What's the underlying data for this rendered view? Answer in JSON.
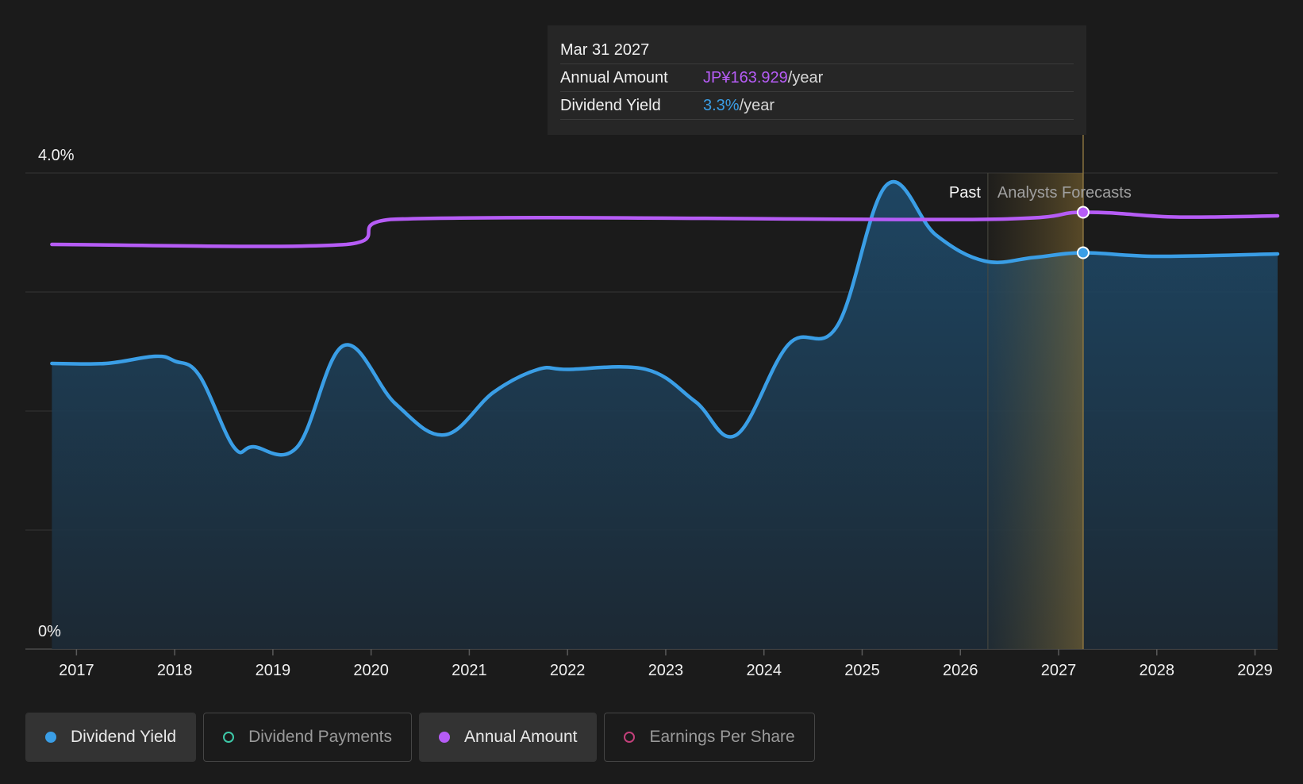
{
  "chart_data": {
    "type": "area",
    "y_ticks": [
      "4.0%",
      "0%"
    ],
    "ylim": [
      0,
      4.0
    ],
    "x_ticks": [
      "2017",
      "2018",
      "2019",
      "2020",
      "2021",
      "2022",
      "2023",
      "2024",
      "2025",
      "2026",
      "2027",
      "2028",
      "2029"
    ],
    "x_range": [
      2016.48,
      2029.23
    ],
    "grid": true,
    "past_label": "Past",
    "forecast_label": "Analysts Forecasts",
    "forecast_start": 2026.28,
    "highlight_x": 2027.25,
    "series": [
      {
        "name": "Dividend Yield",
        "color": "#3a9ee6",
        "points": [
          [
            2016.75,
            2.4
          ],
          [
            2017.3,
            2.4
          ],
          [
            2017.8,
            2.46
          ],
          [
            2018.0,
            2.42
          ],
          [
            2018.25,
            2.3
          ],
          [
            2018.6,
            1.7
          ],
          [
            2018.8,
            1.7
          ],
          [
            2019.25,
            1.7
          ],
          [
            2019.72,
            2.55
          ],
          [
            2020.25,
            2.06
          ],
          [
            2020.75,
            1.8
          ],
          [
            2021.25,
            2.16
          ],
          [
            2021.7,
            2.35
          ],
          [
            2022.0,
            2.35
          ],
          [
            2022.8,
            2.35
          ],
          [
            2023.3,
            2.08
          ],
          [
            2023.72,
            1.8
          ],
          [
            2024.25,
            2.56
          ],
          [
            2024.75,
            2.72
          ],
          [
            2025.25,
            3.9
          ],
          [
            2025.75,
            3.48
          ],
          [
            2026.25,
            3.26
          ],
          [
            2026.75,
            3.29
          ],
          [
            2027.25,
            3.33
          ],
          [
            2028.0,
            3.3
          ],
          [
            2029.23,
            3.32
          ]
        ]
      },
      {
        "name": "Annual Amount",
        "color": "#b65cf6",
        "points": [
          [
            2016.75,
            3.4
          ],
          [
            2019.75,
            3.4
          ],
          [
            2020.2,
            3.61
          ],
          [
            2026.2,
            3.61
          ],
          [
            2027.25,
            3.67
          ],
          [
            2028.2,
            3.63
          ],
          [
            2029.23,
            3.64
          ]
        ]
      }
    ],
    "tooltip": {
      "date": "Mar 31 2027",
      "annual_amount_label": "Annual Amount",
      "annual_amount_value": "JP¥163.929",
      "dividend_yield_label": "Dividend Yield",
      "dividend_yield_value": "3.3%",
      "unit": "/year"
    },
    "legend": [
      {
        "label": "Dividend Yield",
        "color": "#3a9ee6",
        "active": true
      },
      {
        "label": "Dividend Payments",
        "color": "#3dc9a8",
        "active": false
      },
      {
        "label": "Annual Amount",
        "color": "#b65cf6",
        "active": true
      },
      {
        "label": "Earnings Per Share",
        "color": "#c2407a",
        "active": false
      }
    ]
  }
}
